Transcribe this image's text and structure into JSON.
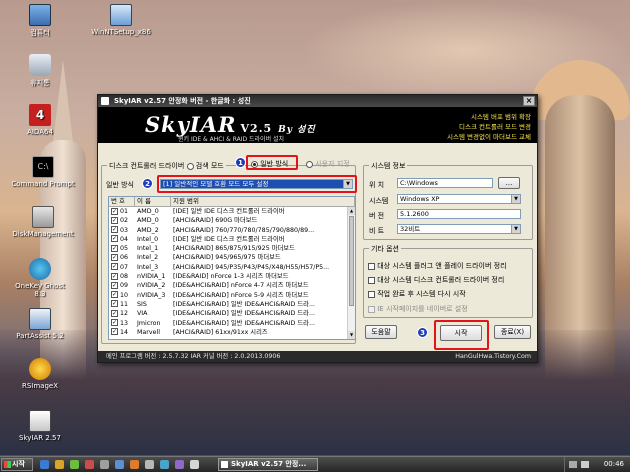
{
  "desktop": {
    "icons": [
      {
        "label": "컴퓨터",
        "icon": "computer-icon"
      },
      {
        "label": "WinNTSetup_x86",
        "icon": "setup-icon"
      },
      {
        "label": "휴지통",
        "icon": "recycle-bin-icon"
      },
      {
        "label": "AIDA64",
        "icon": "aida64-icon"
      },
      {
        "label": "Command Prompt",
        "icon": "command-prompt-icon"
      },
      {
        "label": "DiskManagement",
        "icon": "disk-management-icon"
      },
      {
        "label": "OneKey Ghost 8.3",
        "icon": "onekey-ghost-icon"
      },
      {
        "label": "PartAssist 5.2",
        "icon": "partassist-icon"
      },
      {
        "label": "RSImageX",
        "icon": "rsimagex-icon"
      },
      {
        "label": "SkyIAR 2.57",
        "icon": "skyiar-icon"
      }
    ]
  },
  "window": {
    "title": "SkyIAR v2.57 안정화 버전 - 한글화 : 성진",
    "banner": {
      "logo": "SkyIAR",
      "version": "V2.5",
      "by": "By 성진",
      "subtitle": "윈키 IDE & AHCI & RAID 드라이버 설치",
      "features": [
        "시스템 버포 범위 확장",
        "디스크 컨트롤러 모드 변경",
        "시스템 변경없이 마더보드 교체"
      ]
    },
    "driver_group": {
      "title": "디스크 컨트롤러 드라이버",
      "search_label": "검색 모드",
      "general_label": "일반 방식",
      "user_label": "사용자 지정",
      "general_method_label": "일반 방식",
      "method_value": "[1] 일반적인 모델 호환 모드 모두 설정",
      "table": {
        "headers": [
          "번 호",
          "이 름",
          "지원 범위"
        ],
        "rows": [
          {
            "num": "01",
            "name": "AMD_0",
            "desc": "[IDE] 일반 IDE 디스크 컨트롤러 드라이버"
          },
          {
            "num": "02",
            "name": "AMD_0",
            "desc": "[AHCI&RAID] 690G 마더보드"
          },
          {
            "num": "03",
            "name": "AMD_2",
            "desc": "[AHCI&RAID] 760/770/780/785/790/880/89..."
          },
          {
            "num": "04",
            "name": "Intel_0",
            "desc": "[IDE] 일반 IDE 디스크 컨트롤러 드라이버"
          },
          {
            "num": "05",
            "name": "Intel_1",
            "desc": "[AHCI&RAID] 865/875/915/925 마더보드"
          },
          {
            "num": "06",
            "name": "Intel_2",
            "desc": "[AHCI&RAID] 945/965/975 마더보드"
          },
          {
            "num": "07",
            "name": "Intel_3",
            "desc": "[AHCI&RAID] 945/P35/P43/P45/X48/H55/H57/P5..."
          },
          {
            "num": "08",
            "name": "nVIDIA_1",
            "desc": "[IDE&RAID] nForce 1-3 시리즈 마더보드"
          },
          {
            "num": "09",
            "name": "nVIDIA_2",
            "desc": "[IDE&AHCI&RAID] nForce 4-7 시리즈 마더보드"
          },
          {
            "num": "10",
            "name": "nVIDIA_3",
            "desc": "[IDE&AHCI&RAID] nForce 5-9 시리즈 마더보드"
          },
          {
            "num": "11",
            "name": "SIS",
            "desc": "[IDE&AHCI&RAID] 일반 IDE&AHCI&RAID 드라..."
          },
          {
            "num": "12",
            "name": "VIA",
            "desc": "[IDE&AHCI&RAID] 일반 IDE&AHCI&RAID 드라..."
          },
          {
            "num": "13",
            "name": "Jmicron",
            "desc": "[IDE&AHCI&RAID] 일반 IDE&AHCI&RAID 드라..."
          },
          {
            "num": "14",
            "name": "Marvell",
            "desc": "[AHCI&RAID] 61xx/91xx 시리즈"
          }
        ]
      }
    },
    "system_info": {
      "title": "시스템 정보",
      "location_label": "위 치",
      "location_value": "C:\\Windows",
      "browse_label": "...",
      "system_label": "시스템",
      "system_value": "Windows XP",
      "version_label": "버 전",
      "version_value": "5.1.2600",
      "bits_label": "비 트",
      "bits_value": "32비트"
    },
    "other_options": {
      "title": "기타 옵션",
      "items": [
        "대상 시스템 플러그 앤 플레이 드라이버 정리",
        "대상 시스템 디스크 컨트롤러 드라이버 정리",
        "작업 완료 후 시스템 다시 시작",
        "IE 시작페이지를 네이버로 설정"
      ]
    },
    "buttons": {
      "help": "도움말",
      "start": "시작",
      "exit": "종료(X)"
    },
    "badges": [
      "1",
      "2",
      "3"
    ],
    "status": {
      "left": "메인 프로그램 버전 : 2.5.7.32   IAR 커널 버전 : 2.0.2013.0906",
      "right": "HanGulHwa.Tistory.Com"
    }
  },
  "taskbar": {
    "start_label": "시작",
    "task_label": "SkyIAR v2.57 안정...",
    "clock": "00:46"
  },
  "colors": {
    "highlight": "#e3131a",
    "badge": "#1b3bb8",
    "banner_feature": "#f4e24a"
  }
}
